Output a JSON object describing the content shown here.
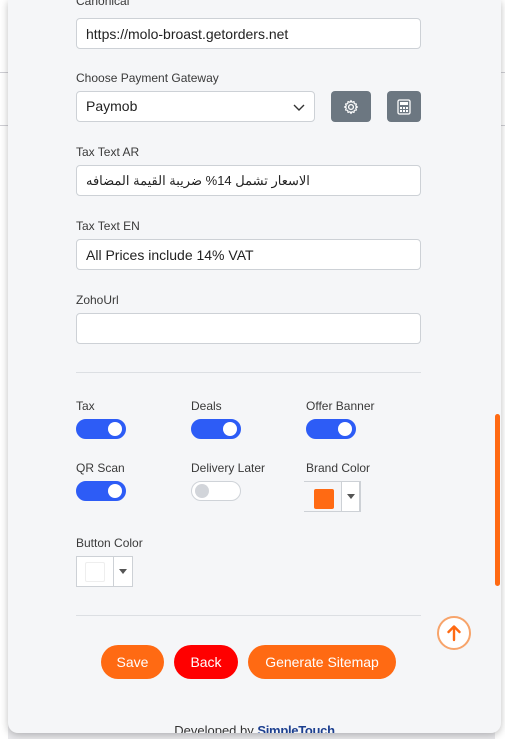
{
  "form": {
    "canonical": {
      "label": "Canonical",
      "value": "https://molo-broast.getorders.net"
    },
    "payment_gateway": {
      "label": "Choose Payment Gateway",
      "selected": "Paymob"
    },
    "tax_text_ar": {
      "label": "Tax Text AR",
      "value": "الاسعار تشمل 14% ضريبة القيمة المضافه"
    },
    "tax_text_en": {
      "label": "Tax Text EN",
      "value": "All Prices include 14% VAT"
    },
    "zoho_url": {
      "label": "ZohoUrl",
      "value": ""
    }
  },
  "toggles": [
    {
      "label": "Tax",
      "on": true
    },
    {
      "label": "Deals",
      "on": true
    },
    {
      "label": "Offer Banner",
      "on": true
    },
    {
      "label": "QR Scan",
      "on": true
    },
    {
      "label": "Delivery Later",
      "on": false
    }
  ],
  "brand_color": {
    "label": "Brand Color",
    "value": "#ff6a13"
  },
  "button_color": {
    "label": "Button Color",
    "value": "#ffffff"
  },
  "actions": {
    "save": "Save",
    "back": "Back",
    "sitemap": "Generate Sitemap"
  },
  "colors": {
    "accent": "#ff6a13",
    "danger": "#ff0000",
    "toggle_on": "#2d5cf6",
    "icon_button": "#6c7781"
  },
  "footer": {
    "prefix": "Developed by",
    "brand": "SimpleTouch"
  }
}
